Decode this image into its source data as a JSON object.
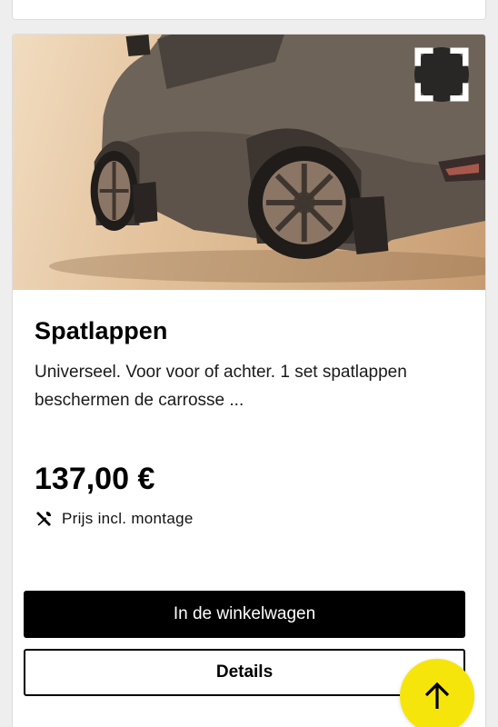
{
  "product": {
    "title": "Spatlappen",
    "description": "Universeel. Voor voor of achter. 1 set spatlappen beschermen de carrosse ...",
    "price": "137,00 €",
    "price_note": "Prijs incl. montage",
    "image_alt": "Spatlappen gemonteerd op de wagen"
  },
  "buttons": {
    "add_to_cart": "In de winkelwagen",
    "details": "Details"
  },
  "icons": {
    "fullscreen": "fullscreen-icon",
    "tools": "tools-icon",
    "scroll_top": "arrow-up-icon"
  },
  "colors": {
    "accent": "#f5e50a",
    "primary_button": "#000000"
  }
}
